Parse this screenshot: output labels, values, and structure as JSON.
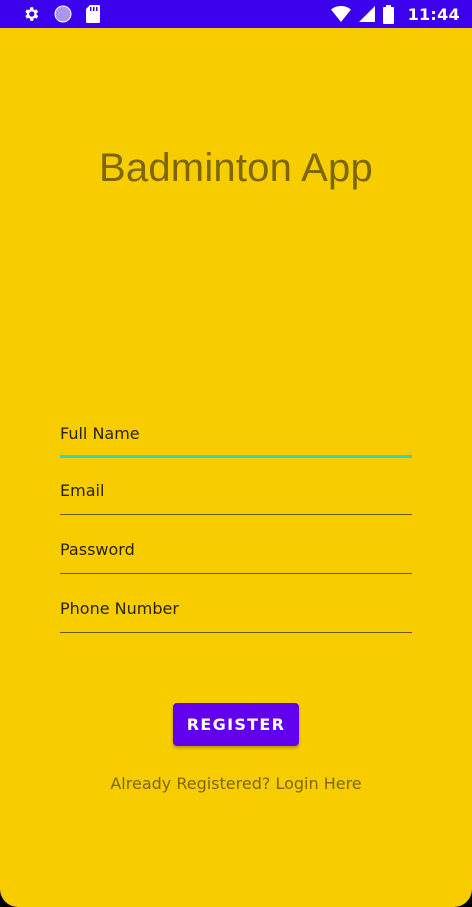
{
  "status_bar": {
    "time": "11:44",
    "left_icons": [
      "gear-icon",
      "circle-icon",
      "sd-card-icon"
    ],
    "right_icons": [
      "wifi-icon",
      "cellular-signal-icon",
      "battery-icon"
    ],
    "color": "#3b00ec"
  },
  "app": {
    "title": "Badminton App",
    "background_color": "#f8cd00"
  },
  "form": {
    "full_name_placeholder": "Full Name",
    "email_placeholder": "Email",
    "password_placeholder": "Password",
    "phone_placeholder": "Phone Number",
    "register_label": "REGISTER",
    "login_link_text": "Already Registered? Login Here",
    "button_color": "#6200ee",
    "active_underline_color": "#2ed9c3"
  }
}
